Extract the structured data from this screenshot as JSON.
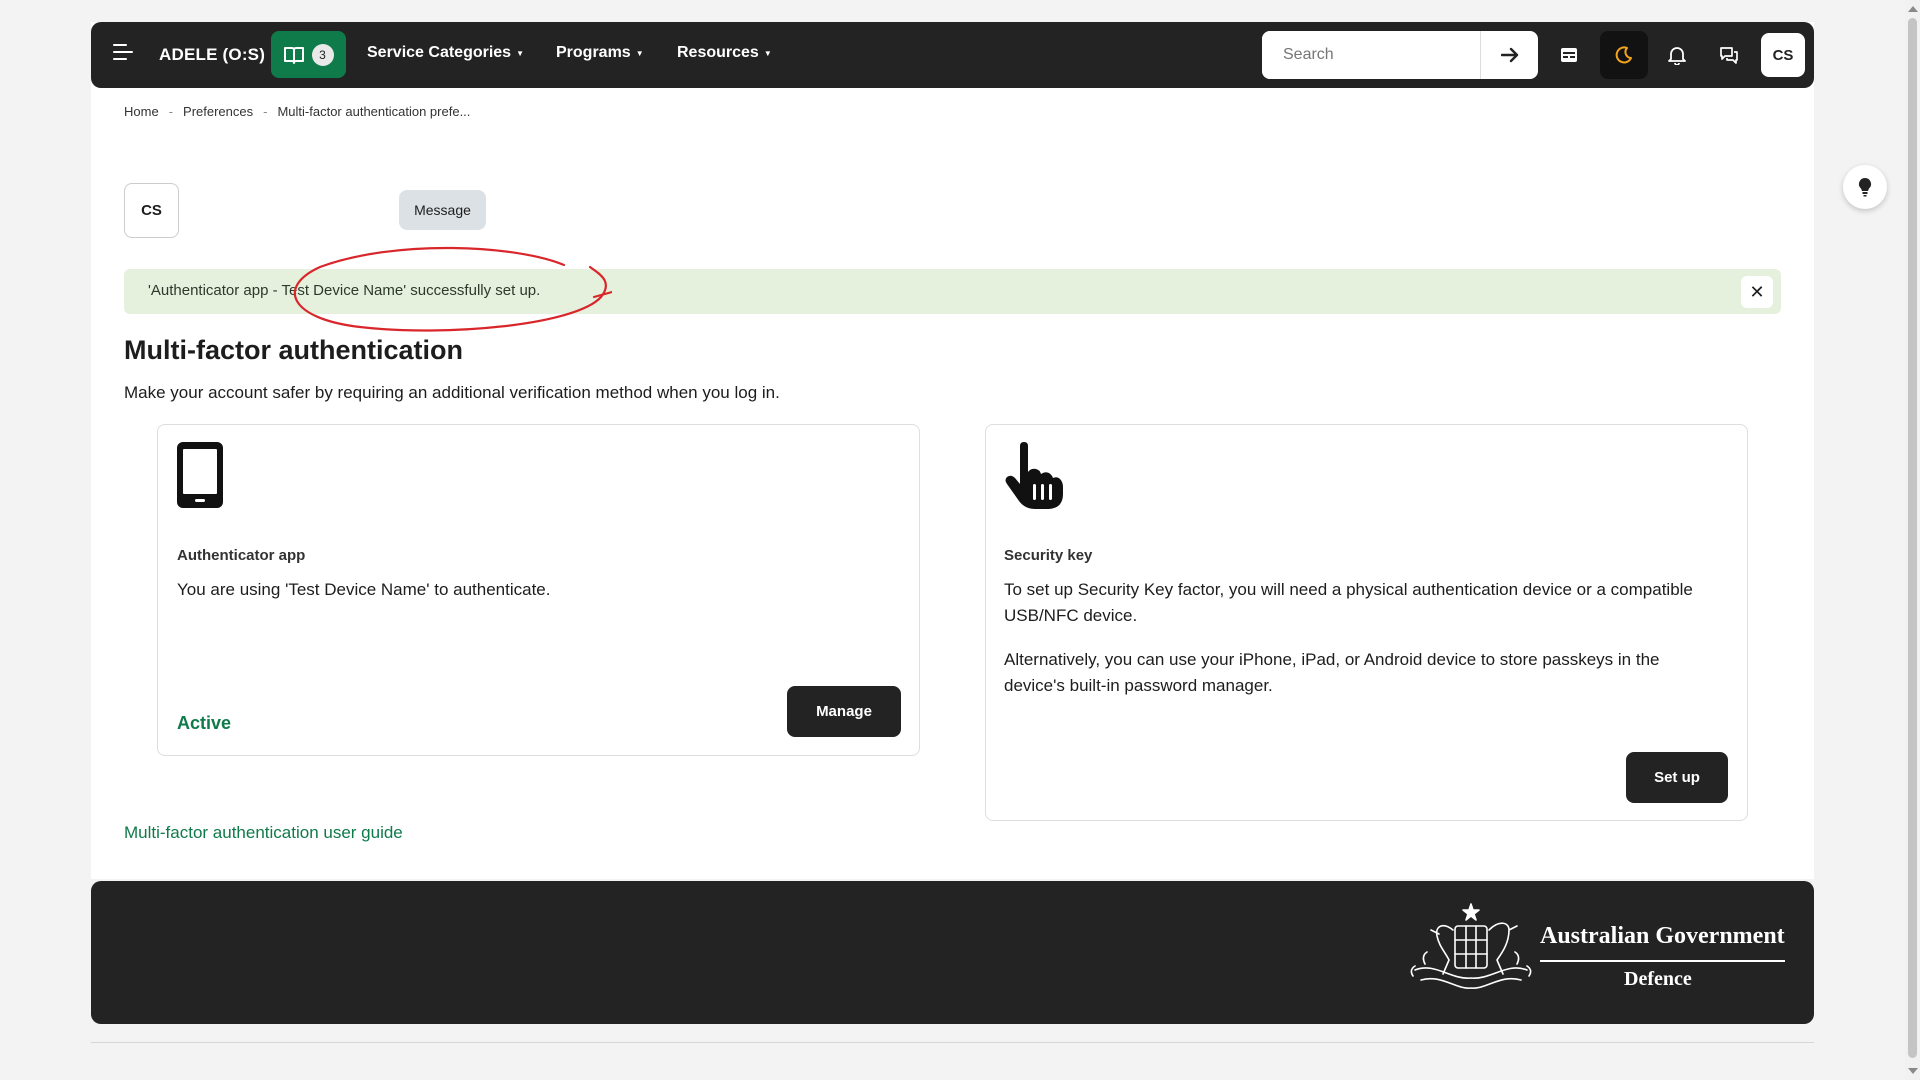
{
  "nav": {
    "site_name": "ADELE (O:S)",
    "course_count": "3",
    "menus": [
      "Service Categories",
      "Programs",
      "Resources"
    ],
    "search_placeholder": "Search",
    "user_initials": "CS"
  },
  "breadcrumb": [
    "Home",
    "Preferences",
    "Multi-factor authentication prefe..."
  ],
  "profile": {
    "initials": "CS",
    "message_label": "Message"
  },
  "alert": {
    "text": "'Authenticator app - Test Device Name' successfully set up."
  },
  "page": {
    "title": "Multi-factor authentication",
    "subtitle": "Make your account safer by requiring an additional verification method when you log in."
  },
  "factors": {
    "authenticator": {
      "title": "Authenticator app",
      "text": "You are using 'Test Device Name' to authenticate.",
      "status": "Active",
      "button": "Manage"
    },
    "security_key": {
      "title": "Security key",
      "text1": "To set up Security Key factor, you will need a physical authentication device or a compatible USB/NFC device.",
      "text2": "Alternatively, you can use your iPhone, iPad, or Android device to store passkeys in the device's built-in password manager.",
      "button": "Set up"
    }
  },
  "guide_link": "Multi-factor authentication user guide",
  "footer": {
    "gov_name": "Australian Government",
    "department": "Defence"
  },
  "colors": {
    "nav_bg": "#232323",
    "accent_green": "#0f7a4a",
    "alert_bg": "#e6f1dd",
    "annotation_red": "#d9262b"
  },
  "icons": [
    "menu-icon",
    "book-icon",
    "arrow-right-icon",
    "calendar-icon",
    "moon-icon",
    "bell-icon",
    "chat-icon",
    "lightbulb-icon",
    "close-icon",
    "phone-icon",
    "pointing-hand-icon"
  ]
}
